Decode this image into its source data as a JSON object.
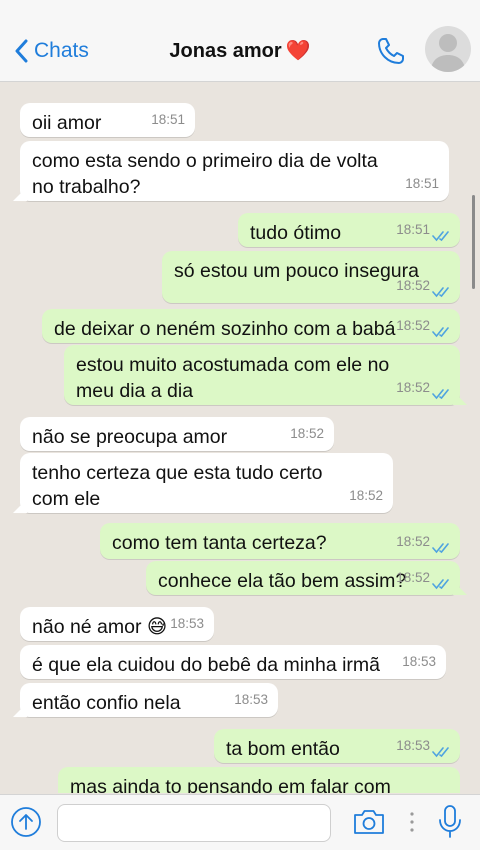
{
  "header": {
    "back_label": "Chats",
    "contact_name": "Jonas amor",
    "contact_emoji": "❤️"
  },
  "colors": {
    "accent": "#1f7ddb",
    "incoming_bubble": "#ffffff",
    "outgoing_bubble": "#dcf8c6",
    "chat_background": "#e9e4de",
    "read_ticks": "#4fa3e0"
  },
  "messages": [
    {
      "dir": "in",
      "text": "oii amor",
      "time": "18:51"
    },
    {
      "dir": "in",
      "text": "como esta sendo o primeiro dia de volta\nno trabalho?",
      "time": "18:51"
    },
    {
      "dir": "out",
      "text": "tudo ótimo",
      "time": "18:51",
      "status": "read"
    },
    {
      "dir": "out",
      "text": "só estou um pouco insegura",
      "time": "18:52",
      "status": "read"
    },
    {
      "dir": "out",
      "text": "de deixar o neném sozinho com a babá",
      "time": "18:52",
      "status": "read"
    },
    {
      "dir": "out",
      "text": "estou muito acostumada com ele no\nmeu dia a dia",
      "time": "18:52",
      "status": "read"
    },
    {
      "dir": "in",
      "text": "não se preocupa amor",
      "time": "18:52"
    },
    {
      "dir": "in",
      "text": "tenho certeza que esta tudo certo\ncom ele",
      "time": "18:52"
    },
    {
      "dir": "out",
      "text": "como tem tanta certeza?",
      "time": "18:52",
      "status": "read"
    },
    {
      "dir": "out",
      "text": "conhece ela tão bem assim?",
      "time": "18:52",
      "status": "read"
    },
    {
      "dir": "in",
      "text": "não né amor 😅",
      "time": "18:53"
    },
    {
      "dir": "in",
      "text": "é que ela cuidou do bebê da minha irmã",
      "time": "18:53"
    },
    {
      "dir": "in",
      "text": "então confio nela",
      "time": "18:53"
    },
    {
      "dir": "out",
      "text": "ta bom então",
      "time": "18:53",
      "status": "read"
    },
    {
      "dir": "out",
      "text": "mas ainda to pensando em falar com",
      "time": "",
      "status": ""
    }
  ],
  "composer": {
    "value": "",
    "placeholder": ""
  },
  "icons": {
    "back": "chevron-left-icon",
    "call": "phone-icon",
    "avatar": "avatar-placeholder",
    "upload": "arrow-up-circle-icon",
    "camera": "camera-icon",
    "more": "vertical-dots-icon",
    "mic": "microphone-icon",
    "ticks": "double-check-icon"
  }
}
